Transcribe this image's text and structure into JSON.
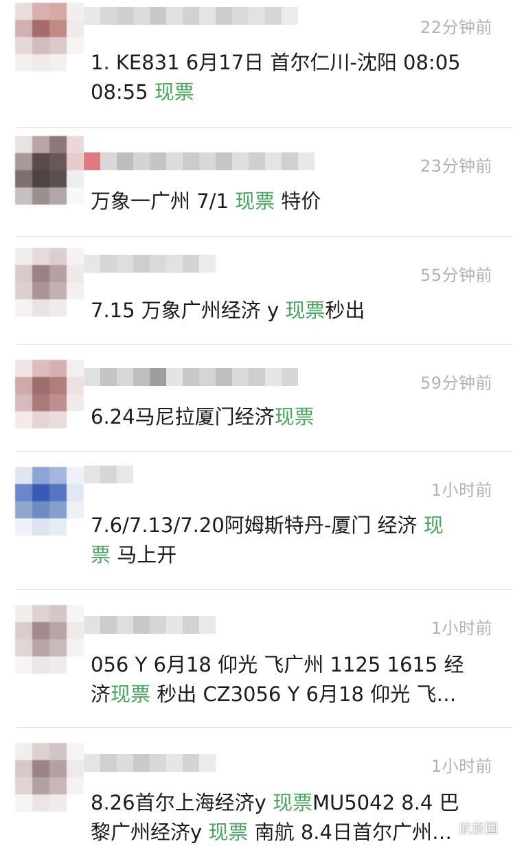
{
  "messages": [
    {
      "time": "22分钟前",
      "parts": [
        {
          "t": "1. KE831 6月17日 首尔仁川-沈阳 08:05\n08:55 "
        },
        {
          "t": "现票",
          "hl": true
        }
      ]
    },
    {
      "time": "23分钟前",
      "parts": [
        {
          "t": "万象一广州 7/1 "
        },
        {
          "t": "现票",
          "hl": true
        },
        {
          "t": " 特价"
        }
      ]
    },
    {
      "time": "55分钟前",
      "parts": [
        {
          "t": "7.15 万象广州经济 y "
        },
        {
          "t": "现票",
          "hl": true
        },
        {
          "t": "秒出"
        }
      ]
    },
    {
      "time": "59分钟前",
      "parts": [
        {
          "t": "6.24马尼拉厦门经济"
        },
        {
          "t": "现票",
          "hl": true
        }
      ]
    },
    {
      "time": "1小时前",
      "parts": [
        {
          "t": "7.6/7.13/7.20阿姆斯特丹-厦门 经济 "
        },
        {
          "t": "现\n票",
          "hl": true
        },
        {
          "t": " 马上开"
        }
      ]
    },
    {
      "time": "1小时前",
      "parts": [
        {
          "t": "056 Y 6月18 仰光 飞广州 1125 1615 经\n济"
        },
        {
          "t": "现票",
          "hl": true
        },
        {
          "t": " 秒出 CZ3056 Y 6月18 仰光 飞…"
        }
      ]
    },
    {
      "time": "1小时前",
      "parts": [
        {
          "t": "8.26首尔上海经济y "
        },
        {
          "t": "现票",
          "hl": true
        },
        {
          "t": "MU5042 8.4 巴\n黎广州经济y "
        },
        {
          "t": "现票",
          "hl": true
        },
        {
          "t": " 南航 8.4日首尔广州…"
        }
      ]
    }
  ],
  "watermark": {
    "label": "航旅圈",
    "icon": "wechat-official-account-icon"
  },
  "colors": {
    "highlight": "#4aa55e",
    "time": "#b3b3b3",
    "divider": "#e6e6e6"
  }
}
